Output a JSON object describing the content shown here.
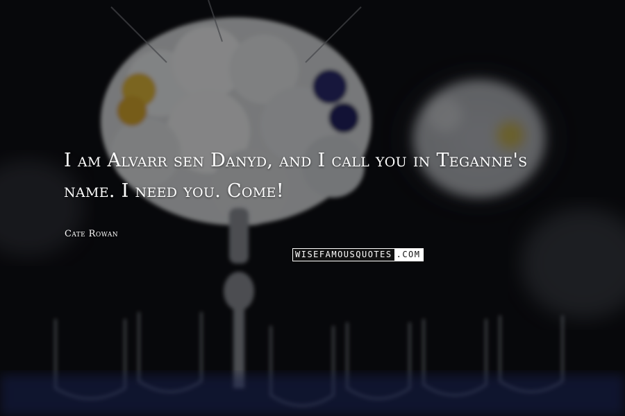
{
  "quote": {
    "text": "I am Alvarr sen Danyd, and I call you in Teganne's name. I need you. Come!",
    "author": "Cate Rowan"
  },
  "watermark": {
    "part1": "WISEFAMOUSQUOTES",
    "part2": ".COM"
  },
  "colors": {
    "text": "#ffffff",
    "background": "#0c0d12"
  }
}
